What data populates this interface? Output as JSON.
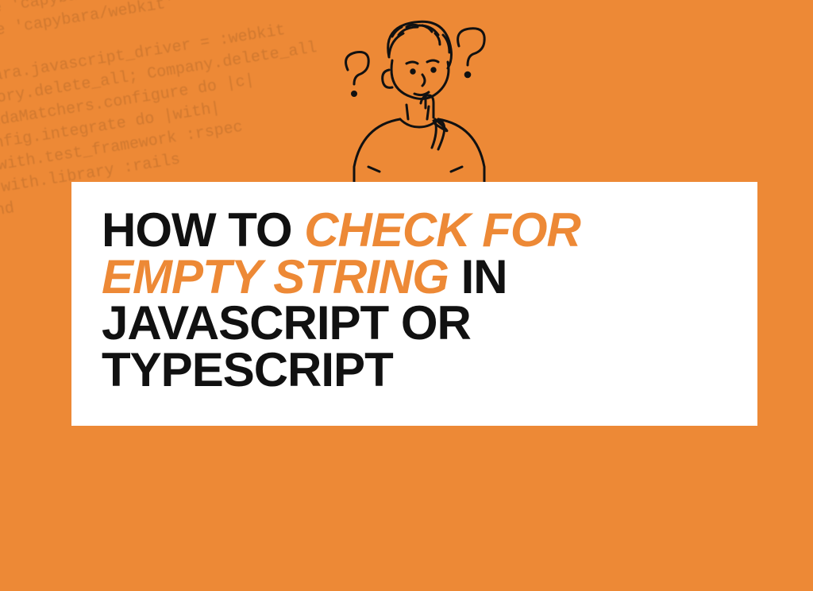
{
  "title": {
    "part1": "HOW TO ",
    "accent": "CHECK FOR EMPTY STRING",
    "part2": " IN JAVASCRIPT OR TYPESCRIPT"
  },
  "bg_code": "    require 'capybara/rspec'\n    require 'capybara/webkit'\n\n    Capybara.javascript_driver = :webkit\n    Category.delete_all; Company.delete_all\n    ShouldaMatchers.configure do |c|\n      config.integrate do |with|\n        with.test_framework :rspec\n        with.library :rails\n      end\n    end"
}
